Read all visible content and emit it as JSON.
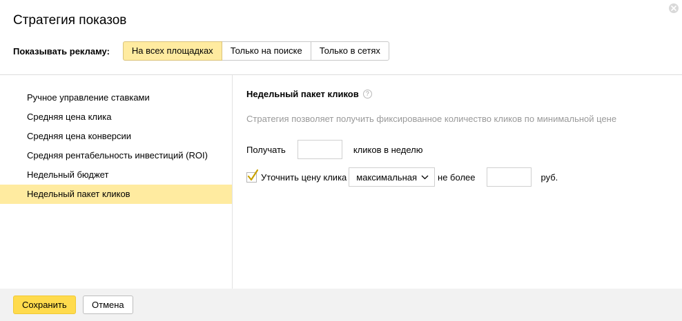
{
  "dialog": {
    "title": "Стратегия показов"
  },
  "show_ads": {
    "label": "Показывать рекламу:",
    "options": [
      {
        "label": "На всех площадках",
        "active": true
      },
      {
        "label": "Только на поиске",
        "active": false
      },
      {
        "label": "Только в сетях",
        "active": false
      }
    ]
  },
  "strategies": [
    {
      "label": "Ручное управление ставками",
      "selected": false
    },
    {
      "label": "Средняя цена клика",
      "selected": false
    },
    {
      "label": "Средняя цена конверсии",
      "selected": false
    },
    {
      "label": "Средняя рентабельность инвестиций (ROI)",
      "selected": false
    },
    {
      "label": "Недельный бюджет",
      "selected": false
    },
    {
      "label": "Недельный пакет кликов",
      "selected": true
    }
  ],
  "content": {
    "title": "Недельный пакет кликов",
    "help_glyph": "?",
    "description": "Стратегия позволяет получить фиксированное количество кликов по минимальной цене",
    "get_label": "Получать",
    "clicks_value": "",
    "clicks_suffix": "кликов в неделю",
    "refine_checked": true,
    "refine_label": "Уточнить цену клика",
    "price_mode": "максимальная",
    "not_more_label": "не более",
    "price_value": "",
    "currency": "руб."
  },
  "footer": {
    "save_label": "Сохранить",
    "cancel_label": "Отмена"
  },
  "colors": {
    "active_bg": "#ffeba0",
    "primary_button": "#ffdb4d",
    "footer_bg": "#f2f2f2",
    "muted_text": "#999999"
  }
}
